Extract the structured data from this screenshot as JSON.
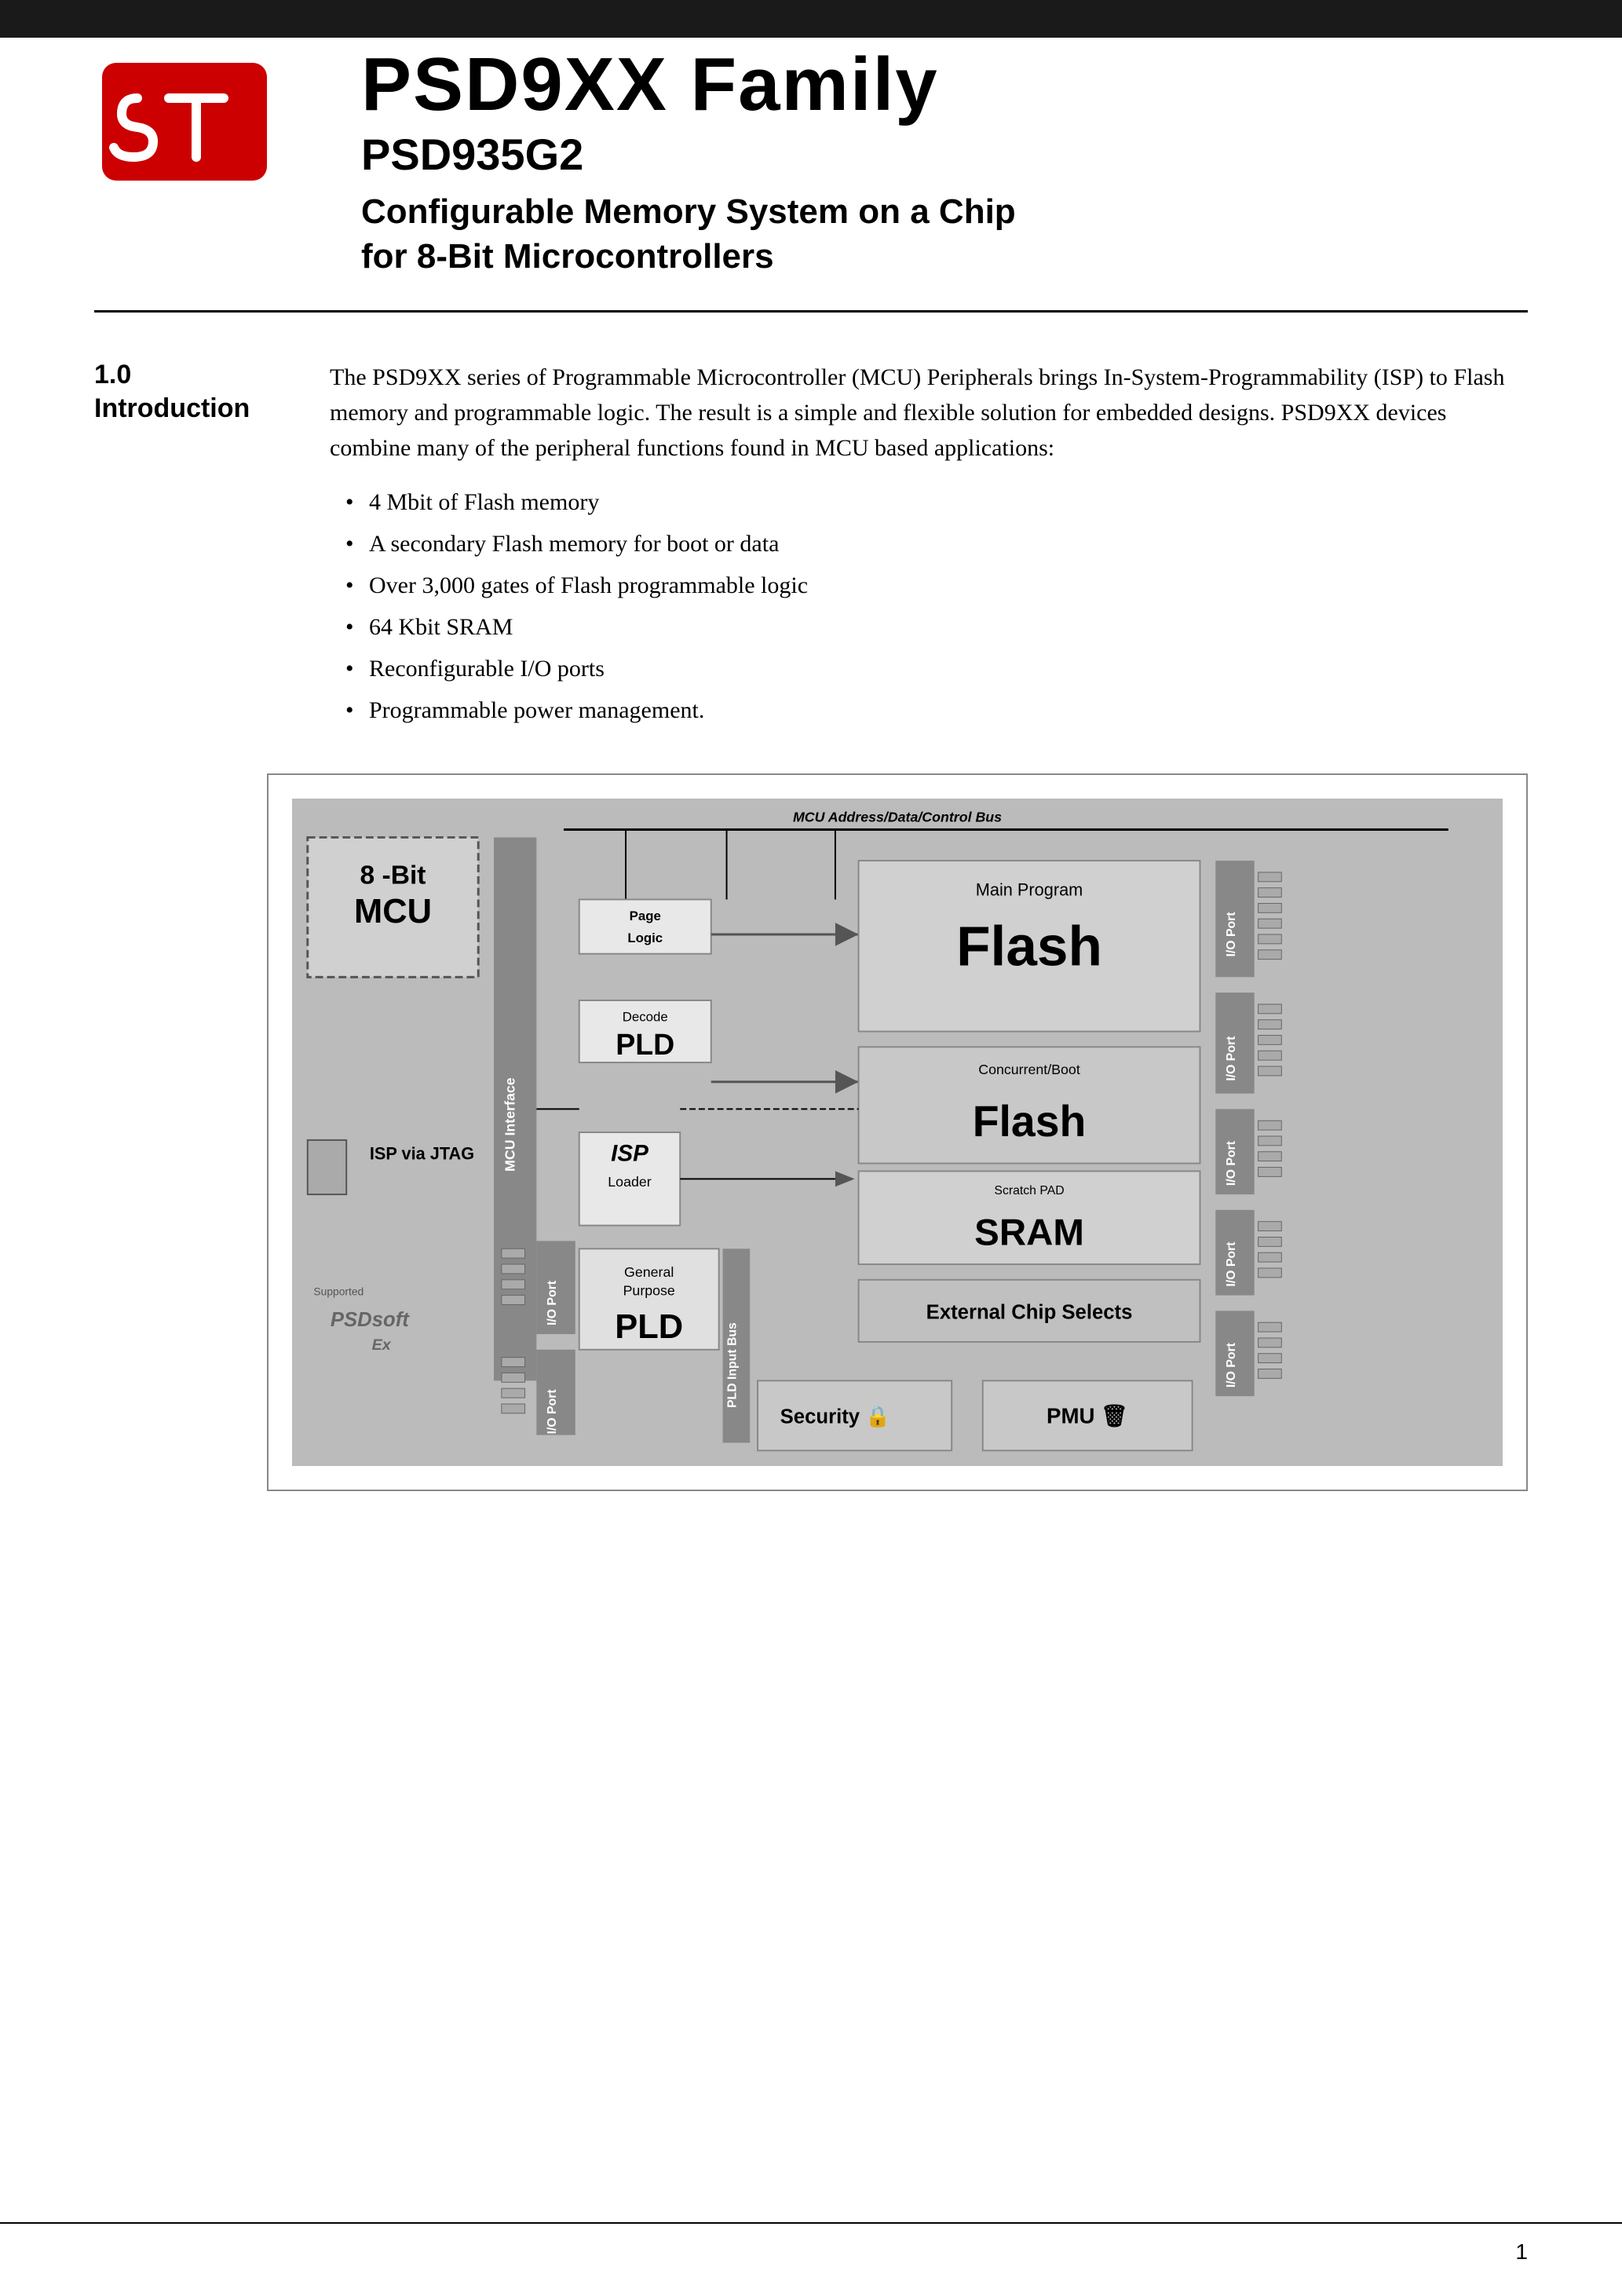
{
  "header": {
    "bar_color": "#1a1a1a",
    "title": "PSD9XX Family",
    "model": "PSD935G2",
    "description_line1": "Configurable Memory System on a Chip",
    "description_line2": "for 8-Bit Microcontrollers"
  },
  "section": {
    "number": "1.0",
    "title": "Introduction",
    "body": "The PSD9XX series of Programmable Microcontroller (MCU) Peripherals brings In-System-Programmability (ISP) to Flash memory and programmable logic. The result is a simple and flexible solution for embedded designs. PSD9XX devices combine many of the peripheral functions found in MCU based applications:",
    "bullets": [
      "4 Mbit of Flash memory",
      "A secondary Flash memory for boot or data",
      "Over 3,000 gates of Flash programmable logic",
      "64 Kbit SRAM",
      "Reconfigurable I/O ports",
      "Programmable power management."
    ]
  },
  "diagram": {
    "bus_label": "MCU Address/Data/Control Bus",
    "mcu_label_line1": "8 -Bit",
    "mcu_label_line2": "MCU",
    "mcu_interface": "MCU Interface",
    "isp_jtag": "ISP via JTAG",
    "isp_label": "ISP",
    "isp_sub": "Loader",
    "page_logic": "Page Logic",
    "decode": "Decode",
    "pld_middle": "PLD",
    "main_program": "Main Program",
    "flash_main": "Flash",
    "concurrent_boot": "Concurrent/Boot",
    "flash_concurrent": "Flash",
    "scratch_pad": "Scratch PAD",
    "sram": "SRAM",
    "general_purpose": "General Purpose",
    "pld_bottom": "PLD",
    "ext_chip_selects": "External Chip Selects",
    "security": "Security",
    "pmu": "PMU",
    "io_port": "I/O Port",
    "pld_input_bus": "PLD Input Bus",
    "supported_by": "Supported",
    "psd_logo": "PSDsofEX"
  },
  "footer": {
    "page_number": "1"
  }
}
